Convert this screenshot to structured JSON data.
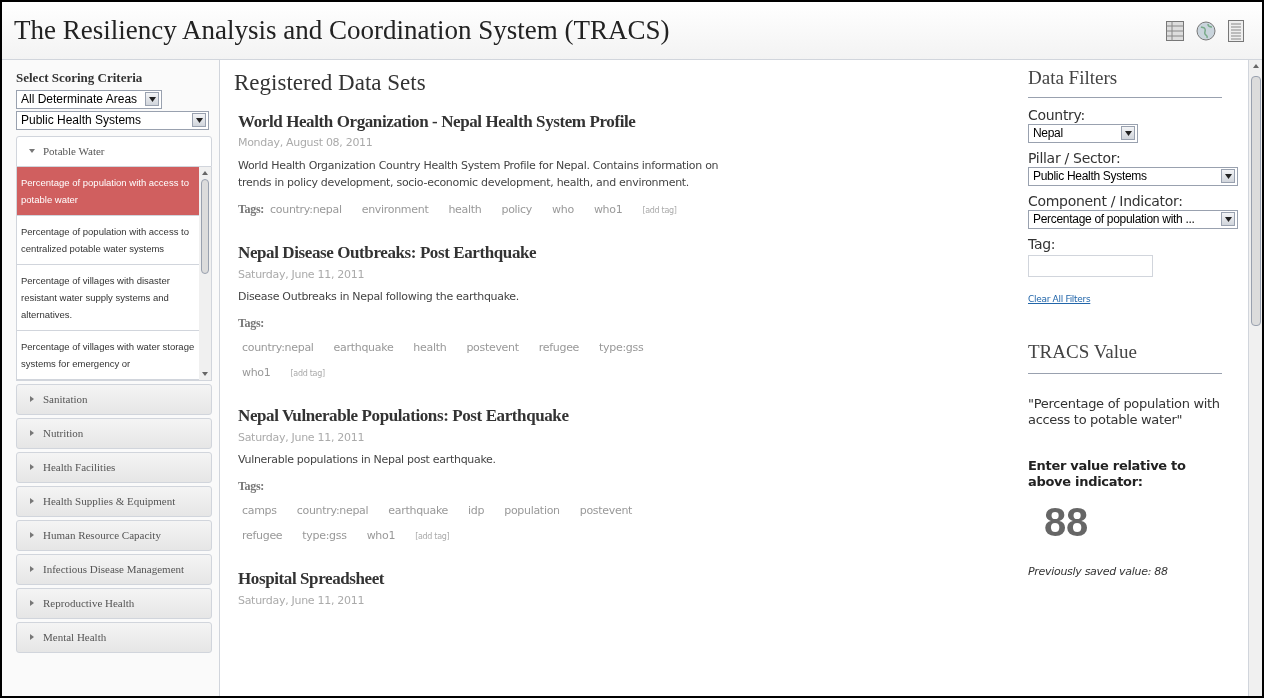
{
  "header": {
    "title": "The Resiliency Analysis and Coordination System (TRACS)"
  },
  "sidebar": {
    "heading": "Select Scoring Criteria",
    "area_select": {
      "value": "All Determinate Areas"
    },
    "system_select": {
      "value": "Public Health Systems"
    },
    "sections": [
      {
        "label": "Potable Water",
        "expanded": true,
        "indicators": [
          {
            "label": "Percentage of population with access to potable water",
            "selected": true
          },
          {
            "label": "Percentage of population with access to centralized potable water systems",
            "selected": false
          },
          {
            "label": "Percentage of villages with disaster resistant water supply systems and alternatives.",
            "selected": false
          },
          {
            "label": "Percentage of villages with water storage systems for emergency or",
            "selected": false
          }
        ]
      },
      {
        "label": "Sanitation",
        "expanded": false
      },
      {
        "label": "Nutrition",
        "expanded": false
      },
      {
        "label": "Health Facilities",
        "expanded": false
      },
      {
        "label": "Health Supplies & Equipment",
        "expanded": false
      },
      {
        "label": "Human Resource Capacity",
        "expanded": false
      },
      {
        "label": "Infectious Disease Management",
        "expanded": false
      },
      {
        "label": "Reproductive Health",
        "expanded": false
      },
      {
        "label": "Mental Health",
        "expanded": false
      }
    ]
  },
  "main": {
    "heading": "Registered Data Sets",
    "datasets": [
      {
        "title": "World Health Organization - Nepal Health System Profile",
        "date": "Monday, August 08, 2011",
        "description": "World Health Organization Country Health System Profile for Nepal. Contains information on trends in policy development, socio-economic development, health, and environment.",
        "tags_label": "Tags:",
        "kind": "compact",
        "tags": [
          "country:nepal",
          "environment",
          "health",
          "policy",
          "who",
          "who1"
        ],
        "add_tag": "[add tag]"
      },
      {
        "title": "Nepal Disease Outbreaks: Post Earthquake",
        "date": "Saturday, June 11, 2011",
        "description": "Disease Outbreaks in Nepal following the earthquake.",
        "tags_label": "Tags:",
        "kind": "full",
        "tags": [
          "country:nepal",
          "earthquake",
          "health",
          "postevent",
          "refugee",
          "type:gss",
          "who1"
        ],
        "add_tag": "[add tag]"
      },
      {
        "title": "Nepal Vulnerable Populations: Post Earthquake",
        "date": "Saturday, June 11, 2011",
        "description": "Vulnerable populations in Nepal post earthquake.",
        "tags_label": "Tags:",
        "kind": "full",
        "tags": [
          "camps",
          "country:nepal",
          "earthquake",
          "idp",
          "population",
          "postevent",
          "refugee",
          "type:gss",
          "who1"
        ],
        "add_tag": "[add tag]"
      },
      {
        "title": "Hospital Spreadsheet",
        "date": "Saturday, June 11, 2011"
      }
    ]
  },
  "filters": {
    "heading": "Data Filters",
    "fields": [
      {
        "kind": "select",
        "label": "Country:",
        "value": "Nepal"
      },
      {
        "kind": "wideselect",
        "label": "Pillar / Sector:",
        "value": "Public Health Systems"
      },
      {
        "kind": "wideselect",
        "label": "Component / Indicator:",
        "value": "Percentage of population with ..."
      },
      {
        "kind": "text",
        "label": "Tag:"
      }
    ],
    "clear_link": "Clear All Filters"
  },
  "tracs_value": {
    "heading": "TRACS Value",
    "indicator": "\"Percentage of population with access to potable water\"",
    "prompt": "Enter value relative to above indicator:",
    "value": "88",
    "previous": "Previously saved value: 88"
  }
}
